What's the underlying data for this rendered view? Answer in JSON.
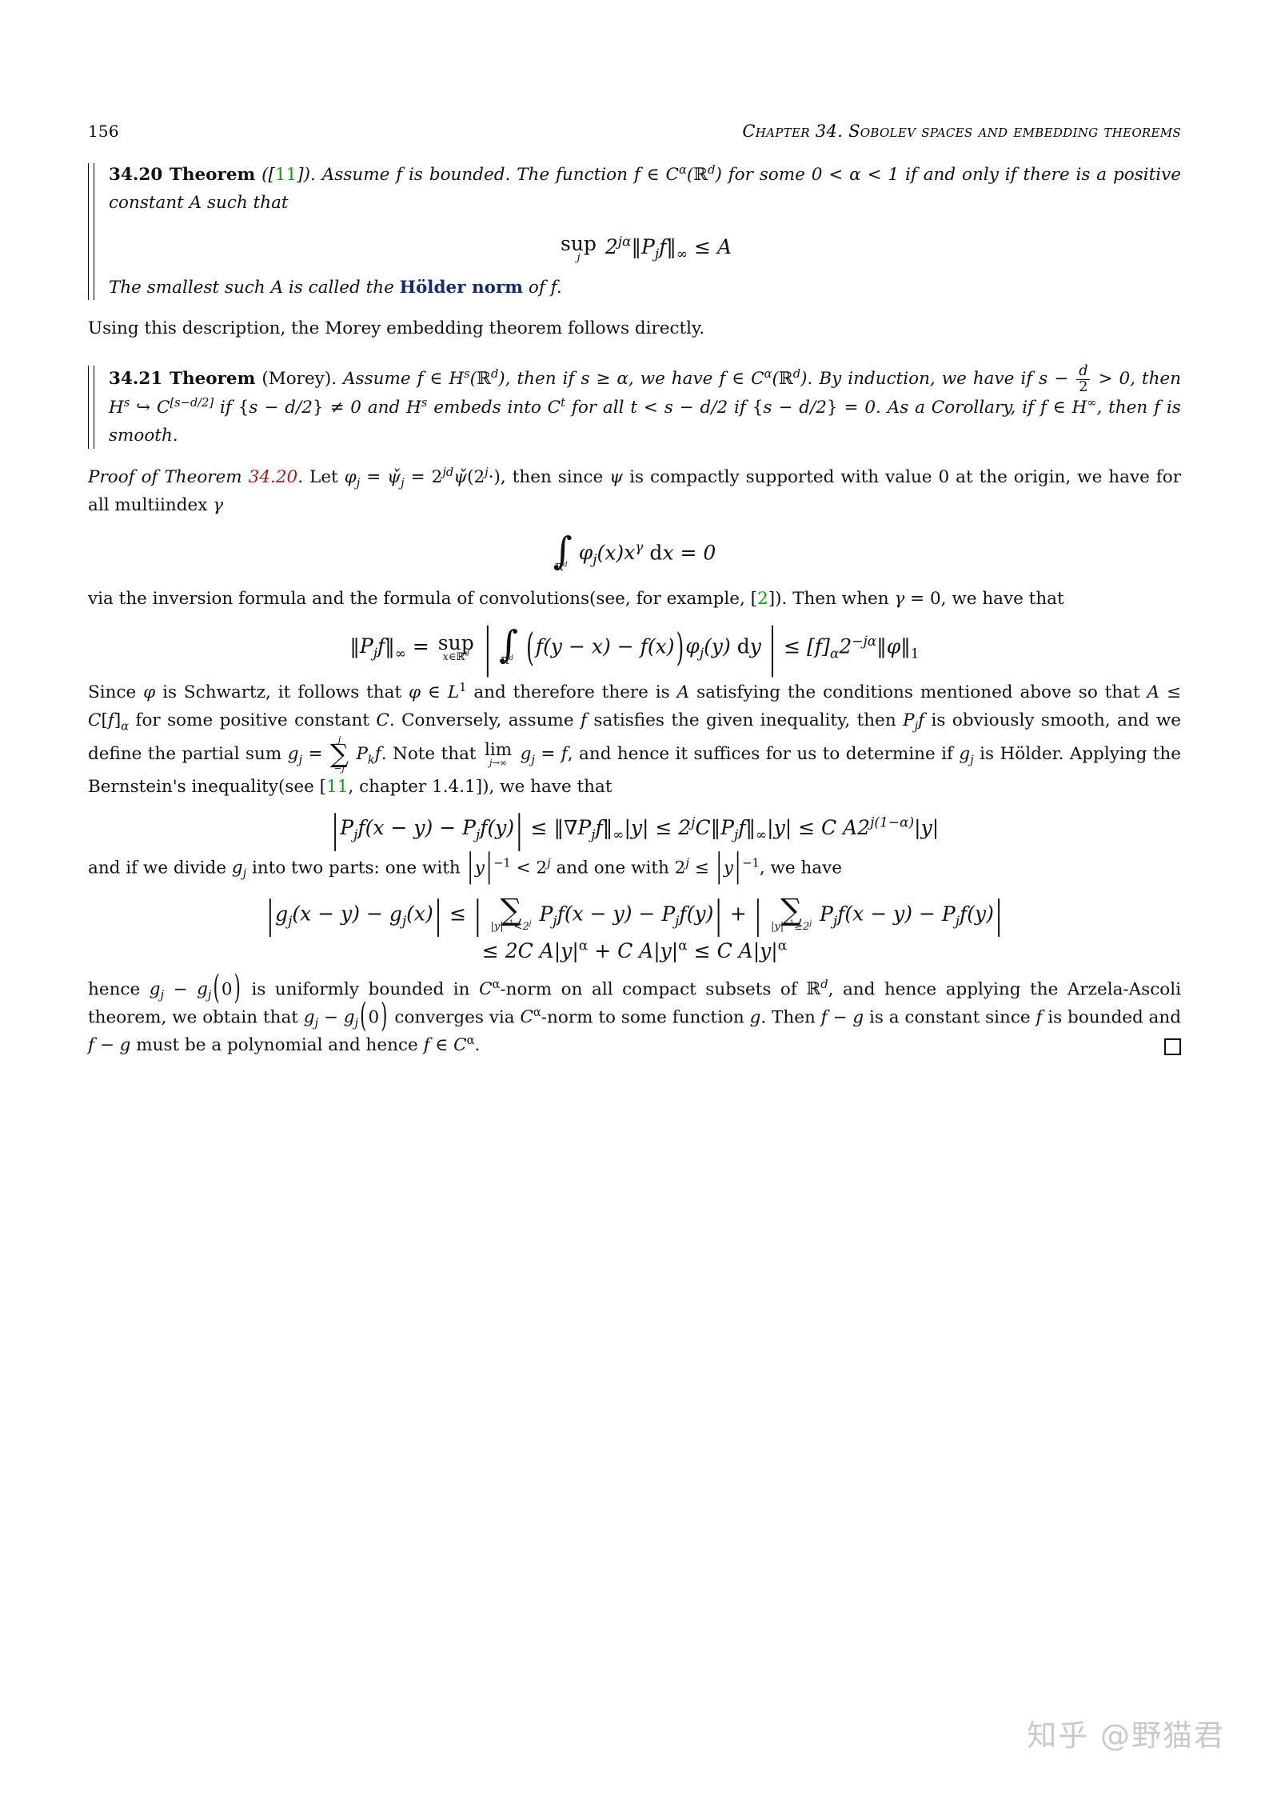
{
  "header": {
    "page_number": "156",
    "chapter_title": "Chapter 34.  Sobolev spaces and embedding theorems"
  },
  "theorem_34_20": {
    "number": "34.20 Theorem",
    "citation_open": " ([",
    "citation": "11",
    "citation_close": "]). ",
    "text_1": "Assume ",
    "f1": "f",
    "text_2": " is bounded. The function ",
    "statement": "Assume f is bounded. The function f ∈ Cα(ℝᵈ) for some 0 < α < 1 if and only if there is a positive constant A such that",
    "tail": "The smallest such A is called the ",
    "hoelder_norm": "Hölder norm",
    "tail2": " of f."
  },
  "equation_1": {
    "sup_label": "sup",
    "sup_sub": "j",
    "body": "2^{jα}‖P_j f‖_∞ ≤ A"
  },
  "intro_morey": "Using this description, the Morey embedding theorem follows directly.",
  "theorem_34_21": {
    "number": "34.21 Theorem",
    "name": " (Morey). ",
    "statement": "Assume f ∈ H^s(ℝ^d), then if s ≥ α, we have f ∈ C^α(ℝ^d). By induction, we have if s − d/2 > 0, then H^s ↪ C^{[s−d/2]} if {s − d/2} ≠ 0 and H^s embeds into C^t for all t < s − d/2 if {s − d/2} = 0. As a Corollary, if f ∈ H^∞, then f is smooth."
  },
  "proof": {
    "lead_label": "Proof of Theorem ",
    "lead_ref": "34.20",
    "lead_ref_dot": ". ",
    "para_1": "Let φ_j = ψ̌_j = 2^{jd}ψ̌(2^j ·), then since ψ is compactly supported with value 0 at the origin, we have for all multiindex γ",
    "para_2_pre": "via the inversion formula and the formula of convolutions(see, for example, [",
    "para_2_cite": "2",
    "para_2_post": "]). Then when γ = 0, we have that",
    "para_3": "Since φ is Schwartz, it follows that φ ∈ L¹ and therefore there is A satisfying the conditions mentioned above so that A ≤ C[f]_α for some positive constant C. Conversely, assume f satisfies the given inequality, then P_j f is obviously smooth, and we define the partial sum g_j = Σ_{-j}^{j} P_k f. Note that lim_{j→∞} g_j = f, and hence it suffices for us to determine if g_j is Hölder. Applying the Bernstein's inequality(see [11, chapter 1.4.1]), we have that",
    "para_3_cite": "11",
    "para_3_cite_tail": ", chapter 1.4.1]), we have that",
    "para_4": "and if we divide g_j into two parts: one with |y|⁻¹ < 2^j and one with 2^j ≤ |y|⁻¹, we have",
    "para_5": "hence g_j − g_j(0) is uniformly bounded in C^α-norm on all compact subsets of ℝ^d, and hence applying the Arzela-Ascoli theorem, we obtain that g_j − g_j(0) converges via C^α-norm to some function g. Then f − g is a constant since f is bounded and f − g must be a polynomial and hence f ∈ C^α."
  },
  "watermark": "知乎 @野猫君",
  "colors": {
    "citation_green": "#10a010",
    "reference_red": "#9b1c1c",
    "hoelder_blue": "#132a6b",
    "watermark_gray": "#c9c9c9"
  }
}
